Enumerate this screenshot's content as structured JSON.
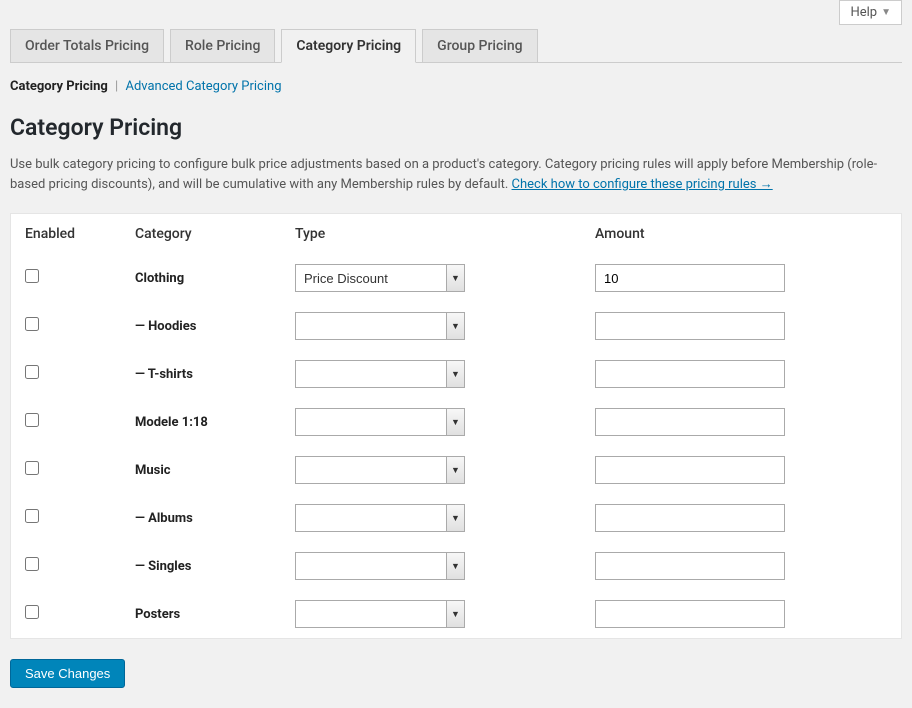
{
  "help": {
    "label": "Help"
  },
  "tabs": [
    {
      "label": "Order Totals Pricing",
      "active": false
    },
    {
      "label": "Role Pricing",
      "active": false
    },
    {
      "label": "Category Pricing",
      "active": true
    },
    {
      "label": "Group Pricing",
      "active": false
    }
  ],
  "subtabs": {
    "current": "Category Pricing",
    "other": "Advanced Category Pricing"
  },
  "page": {
    "title": "Category Pricing",
    "description": "Use bulk category pricing to configure bulk price adjustments based on a product's category. Category pricing rules will apply before Membership (role-based pricing discounts), and will be cumulative with any Membership rules by default. ",
    "help_link": "Check how to configure these pricing rules →"
  },
  "table": {
    "headers": {
      "enabled": "Enabled",
      "category": "Category",
      "type": "Type",
      "amount": "Amount"
    },
    "type_options": [
      "",
      "Price Discount"
    ]
  },
  "rows": [
    {
      "enabled": false,
      "category": "Clothing",
      "type": "Price Discount",
      "amount": "10"
    },
    {
      "enabled": false,
      "category": "— Hoodies",
      "type": "",
      "amount": ""
    },
    {
      "enabled": false,
      "category": "— T-shirts",
      "type": "",
      "amount": ""
    },
    {
      "enabled": false,
      "category": "Modele 1:18",
      "type": "",
      "amount": ""
    },
    {
      "enabled": false,
      "category": "Music",
      "type": "",
      "amount": ""
    },
    {
      "enabled": false,
      "category": "— Albums",
      "type": "",
      "amount": ""
    },
    {
      "enabled": false,
      "category": "— Singles",
      "type": "",
      "amount": ""
    },
    {
      "enabled": false,
      "category": "Posters",
      "type": "",
      "amount": ""
    }
  ],
  "actions": {
    "save": "Save Changes"
  }
}
